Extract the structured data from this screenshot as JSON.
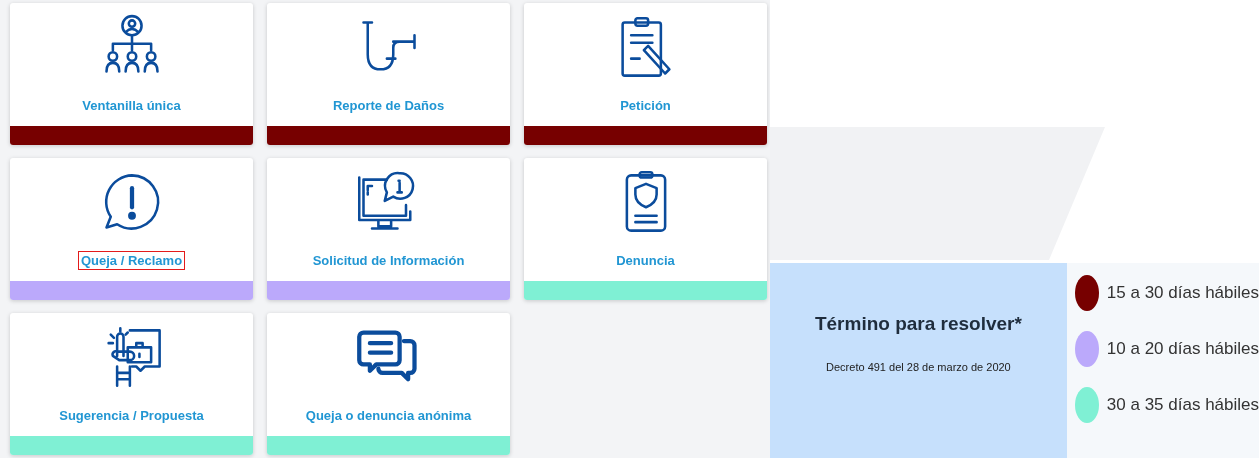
{
  "cards": [
    {
      "label": "Ventanilla única",
      "color": "#770000",
      "focused": false
    },
    {
      "label": "Reporte de Daños",
      "color": "#770000",
      "focused": false
    },
    {
      "label": "Petición",
      "color": "#770000",
      "focused": false
    },
    {
      "label": "Queja / Reclamo",
      "color": "#bba9fb",
      "focused": true
    },
    {
      "label": "Solicitud de Información",
      "color": "#bba9fb",
      "focused": false
    },
    {
      "label": "Denuncia",
      "color": "#7ff0d4",
      "focused": false
    },
    {
      "label": "Sugerencia / Propuesta",
      "color": "#7ff0d4",
      "focused": false
    },
    {
      "label": "Queja o denuncia anónima",
      "color": "#7ff0d4",
      "focused": false
    }
  ],
  "term_panel": {
    "title": "Término para resolver*",
    "note": "Decreto 491 del 28 de marzo de 2020"
  },
  "legend": [
    {
      "label": "15 a 30 días hábiles",
      "color": "#770000"
    },
    {
      "label": "10 a 20 días hábiles",
      "color": "#bba9fb"
    },
    {
      "label": "30 a 35 días hábiles",
      "color": "#7ff0d4"
    }
  ]
}
